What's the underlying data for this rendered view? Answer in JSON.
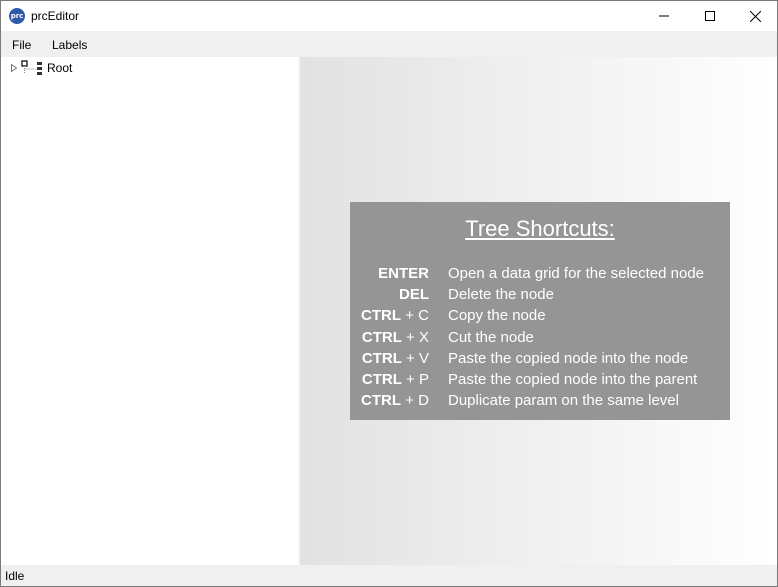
{
  "window": {
    "title": "prcEditor",
    "icon_text": "prc"
  },
  "menu": {
    "items": [
      "File",
      "Labels"
    ]
  },
  "tree": {
    "root_label": "Root"
  },
  "shortcuts": {
    "title": "Tree Shortcuts:",
    "rows": [
      {
        "modifier": "",
        "plus": "",
        "key": "ENTER",
        "description": "Open a data grid for the selected node"
      },
      {
        "modifier": "",
        "plus": "",
        "key": "DEL",
        "description": "Delete the node"
      },
      {
        "modifier": "CTRL",
        "plus": " + ",
        "key": "C",
        "description": "Copy the node"
      },
      {
        "modifier": "CTRL",
        "plus": " + ",
        "key": "X",
        "description": "Cut the node"
      },
      {
        "modifier": "CTRL",
        "plus": " + ",
        "key": "V",
        "description": "Paste the copied node into the node"
      },
      {
        "modifier": "CTRL",
        "plus": " + ",
        "key": "P",
        "description": "Paste the copied node into the parent"
      },
      {
        "modifier": "CTRL",
        "plus": " + ",
        "key": "D",
        "description": "Duplicate param on the same level"
      }
    ]
  },
  "status": {
    "text": "Idle"
  },
  "colors": {
    "shortcut_box": "#959595",
    "app_icon": "#2f5aa8"
  }
}
